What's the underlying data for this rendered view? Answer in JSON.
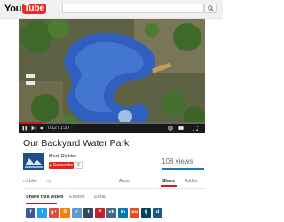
{
  "header": {
    "logo_you": "You",
    "logo_tube": "Tube",
    "search_placeholder": ""
  },
  "player": {
    "current_time": "0:12",
    "duration": "1:30",
    "progress_fraction": 0.13
  },
  "video": {
    "title": "Our Backyard Water Park",
    "channel_name": "Mark Richter",
    "subscribe_label": "Subscribe",
    "subscriber_count": "6",
    "views": "108 views",
    "likes_fraction": 1.0
  },
  "actions": {
    "like_label": "Like",
    "about_label": "About",
    "share_label": "Share",
    "add_to_label": "Add to"
  },
  "share": {
    "tabs": [
      "Share this video",
      "Embed",
      "Email"
    ],
    "icons": [
      {
        "name": "facebook",
        "glyph": "f",
        "color": "#3b5998"
      },
      {
        "name": "twitter",
        "glyph": "t",
        "color": "#1da1f2"
      },
      {
        "name": "google-plus",
        "glyph": "g+",
        "color": "#dd4b39"
      },
      {
        "name": "blogger",
        "glyph": "B",
        "color": "#f57d00"
      },
      {
        "name": "reddit",
        "glyph": "r",
        "color": "#5f99cf"
      },
      {
        "name": "tumblr",
        "glyph": "t",
        "color": "#35465c"
      },
      {
        "name": "pinterest",
        "glyph": "P",
        "color": "#cb2027"
      },
      {
        "name": "vk",
        "glyph": "vk",
        "color": "#45668e"
      },
      {
        "name": "linkedin",
        "glyph": "in",
        "color": "#0077b5"
      },
      {
        "name": "stumbleupon",
        "glyph": "su",
        "color": "#eb4924"
      },
      {
        "name": "livejournal",
        "glyph": "lj",
        "color": "#004359"
      },
      {
        "name": "digg",
        "glyph": "d",
        "color": "#1b5791"
      }
    ]
  },
  "colors": {
    "brand_red": "#e52d27",
    "subscribe_red": "#e62117",
    "pool_blue": "#2f5fbf",
    "foliage_green": "#3d6a2a"
  }
}
